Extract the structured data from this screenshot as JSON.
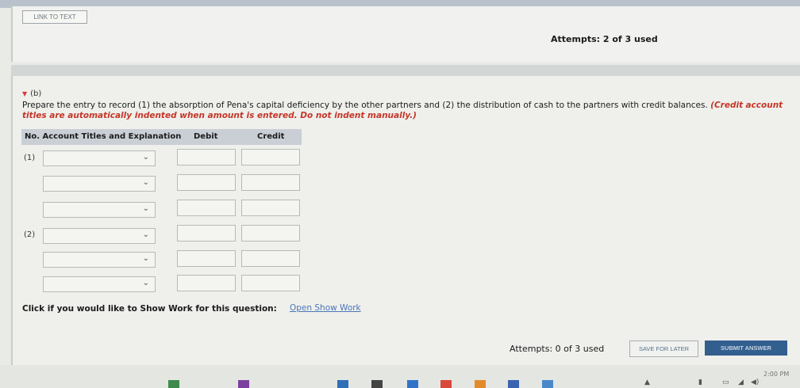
{
  "header": {
    "link_to_text": "LINK TO TEXT",
    "attempts_top": "Attempts: 2 of 3 used"
  },
  "part": {
    "label": "(b)",
    "prompt_text": "Prepare the entry to record (1) the absorption of Pena's capital deficiency by the other partners and (2) the distribution of cash to the partners with credit balances.",
    "prompt_note_line1": "(Credit",
    "prompt_note_line2": "account titles are automatically indented when amount is entered. Do not indent manually.)"
  },
  "table": {
    "headers": {
      "no_account": "No. Account Titles and Explanation",
      "debit": "Debit",
      "credit": "Credit"
    },
    "entries": [
      {
        "label": "(1)"
      },
      {
        "label": "(2)"
      }
    ]
  },
  "show_work": {
    "prompt": "Click if you would like to Show Work for this question:",
    "link": "Open Show Work"
  },
  "footer": {
    "attempts_bottom": "Attempts: 0 of 3 used",
    "save_label": "SAVE FOR LATER",
    "submit_label": "SUBMIT ANSWER"
  },
  "taskbar": {
    "time": "2:00 PM"
  },
  "colors": {
    "accent_red": "#c63528",
    "link_blue": "#4a76b8",
    "submit_bg": "#335f8f"
  }
}
